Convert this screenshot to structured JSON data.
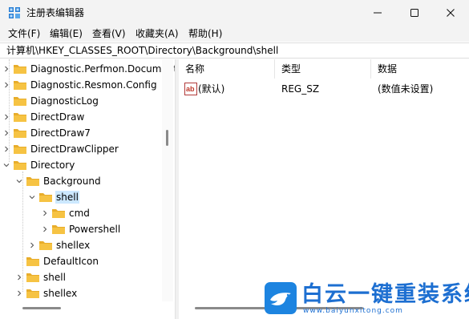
{
  "window": {
    "title": "注册表编辑器",
    "controls": {
      "minimize": "minimize-icon",
      "maximize": "maximize-icon",
      "close": "close-icon"
    }
  },
  "menu": [
    {
      "label": "文件(F)"
    },
    {
      "label": "编辑(E)"
    },
    {
      "label": "查看(V)"
    },
    {
      "label": "收藏夹(A)"
    },
    {
      "label": "帮助(H)"
    }
  ],
  "address": {
    "path": "计算机\\HKEY_CLASSES_ROOT\\Directory\\Background\\shell"
  },
  "tree": {
    "nodes": [
      {
        "label": "Diagnostic.Perfmon.Document",
        "level": 0,
        "chevron": "right",
        "selected": false
      },
      {
        "label": "Diagnostic.Resmon.Config",
        "level": 0,
        "chevron": "right",
        "selected": false
      },
      {
        "label": "DiagnosticLog",
        "level": 0,
        "chevron": "none",
        "selected": false
      },
      {
        "label": "DirectDraw",
        "level": 0,
        "chevron": "right",
        "selected": false
      },
      {
        "label": "DirectDraw7",
        "level": 0,
        "chevron": "right",
        "selected": false
      },
      {
        "label": "DirectDrawClipper",
        "level": 0,
        "chevron": "right",
        "selected": false
      },
      {
        "label": "Directory",
        "level": 0,
        "chevron": "down",
        "selected": false
      },
      {
        "label": "Background",
        "level": 1,
        "chevron": "down",
        "selected": false
      },
      {
        "label": "shell",
        "level": 2,
        "chevron": "down",
        "selected": true
      },
      {
        "label": "cmd",
        "level": 3,
        "chevron": "right",
        "selected": false
      },
      {
        "label": "Powershell",
        "level": 3,
        "chevron": "right",
        "selected": false
      },
      {
        "label": "shellex",
        "level": 2,
        "chevron": "right",
        "selected": false
      },
      {
        "label": "DefaultIcon",
        "level": 1,
        "chevron": "none",
        "selected": false
      },
      {
        "label": "shell",
        "level": 1,
        "chevron": "right",
        "selected": false
      },
      {
        "label": "shellex",
        "level": 1,
        "chevron": "right",
        "selected": false
      }
    ]
  },
  "list": {
    "headers": {
      "name": "名称",
      "type": "类型",
      "data": "数据"
    },
    "rows": [
      {
        "icon": "ab-string-value-icon",
        "name": "(默认)",
        "type": "REG_SZ",
        "data": "(数值未设置)"
      }
    ]
  },
  "watermark": {
    "icon": "bird-logo-icon",
    "text": "白云一键重装系统",
    "url": "www.baiyunxitong.com"
  },
  "colors": {
    "selection": "#cce8ff",
    "folder": "#f6c343",
    "watermark": "#1d6fd1",
    "titlebar": "#f3f3f3"
  }
}
